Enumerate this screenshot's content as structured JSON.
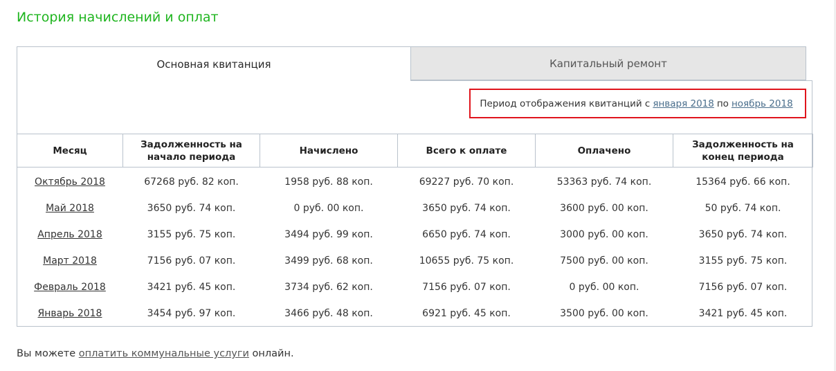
{
  "header": {
    "title": "История начислений и оплат"
  },
  "tabs": [
    {
      "label": "Основная квитанция",
      "active": true
    },
    {
      "label": "Капитальный ремонт",
      "active": false
    }
  ],
  "period": {
    "prefix": "Период отображения квитанций с",
    "from_link": "января 2018",
    "middle": "по",
    "to_link": "ноябрь 2018"
  },
  "table": {
    "headers": [
      "Месяц",
      "Задолженность на начало периода",
      "Начислено",
      "Всего к оплате",
      "Оплачено",
      "Задолженность на конец периода"
    ],
    "rows": [
      [
        "Октябрь 2018",
        "67268 руб. 82 коп.",
        "1958 руб. 88 коп.",
        "69227 руб. 70 коп.",
        "53363 руб. 74 коп.",
        "15364 руб. 66 коп."
      ],
      [
        "Май 2018",
        "3650 руб. 74 коп.",
        "0 руб. 00 коп.",
        "3650 руб. 74 коп.",
        "3600 руб. 00 коп.",
        "50 руб. 74 коп."
      ],
      [
        "Апрель 2018",
        "3155 руб. 75 коп.",
        "3494 руб. 99 коп.",
        "6650 руб. 74 коп.",
        "3000 руб. 00 коп.",
        "3650 руб. 74 коп."
      ],
      [
        "Март 2018",
        "7156 руб. 07 коп.",
        "3499 руб. 68 коп.",
        "10655 руб. 75 коп.",
        "7500 руб. 00 коп.",
        "3155 руб. 75 коп."
      ],
      [
        "Февраль 2018",
        "3421 руб. 45 коп.",
        "3734 руб. 62 коп.",
        "7156 руб. 07 коп.",
        "0 руб. 00 коп.",
        "7156 руб. 07 коп."
      ],
      [
        "Январь 2018",
        "3454 руб. 97 коп.",
        "3466 руб. 48 коп.",
        "6921 руб. 45 коп.",
        "3500 руб. 00 коп.",
        "3421 руб. 45 коп."
      ]
    ]
  },
  "footer": {
    "prefix": "Вы можете",
    "link": "оплатить коммунальные услуги",
    "suffix": "онлайн."
  },
  "colors": {
    "title": "#1fb51f",
    "highlight_border": "#e0141c",
    "link": "#4a6e8c",
    "table_border": "#b9c2cc",
    "inactive_tab_bg": "#e6e6e6"
  }
}
